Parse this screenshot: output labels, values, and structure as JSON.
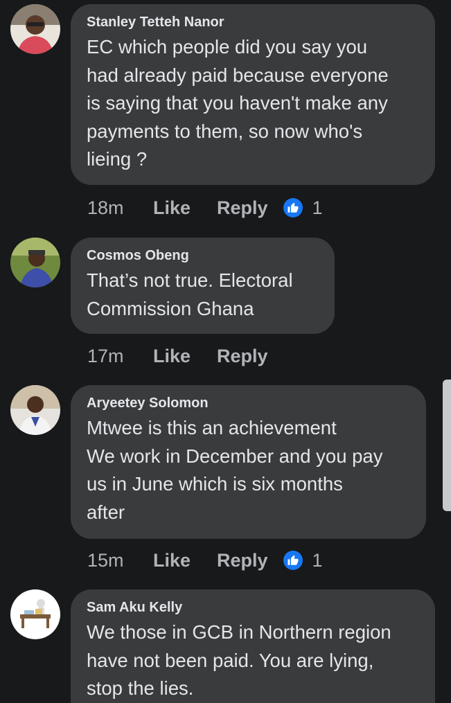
{
  "comments": [
    {
      "author": "Stanley Tetteh Nanor",
      "text": "EC which people did you say you\nhad already paid because everyone\nis saying that you haven't make any\npayments to them, so now who's\nlieing ?",
      "time": "18m",
      "like_label": "Like",
      "reply_label": "Reply",
      "reaction_icon": "like-reaction-icon",
      "reaction_count": "1"
    },
    {
      "author": "Cosmos Obeng",
      "text": "That’s not true. Electoral\nCommission Ghana",
      "time": "17m",
      "like_label": "Like",
      "reply_label": "Reply"
    },
    {
      "author": "Aryeetey Solomon",
      "text": "Mtwee is this an achievement\nWe work in December and you pay\nus in June which is six months\nafter",
      "time": "15m",
      "like_label": "Like",
      "reply_label": "Reply",
      "reaction_icon": "like-reaction-icon",
      "reaction_count": "1"
    },
    {
      "author": "Sam Aku Kelly",
      "text": "We those in GCB in Northern region\nhave not been paid. You are lying,\nstop the lies."
    }
  ],
  "colors": {
    "background": "#18191a",
    "bubble": "#3a3b3c",
    "text": "#e4e6eb",
    "secondary_text": "#b0b3b8",
    "reaction_blue": "#1877f2"
  }
}
